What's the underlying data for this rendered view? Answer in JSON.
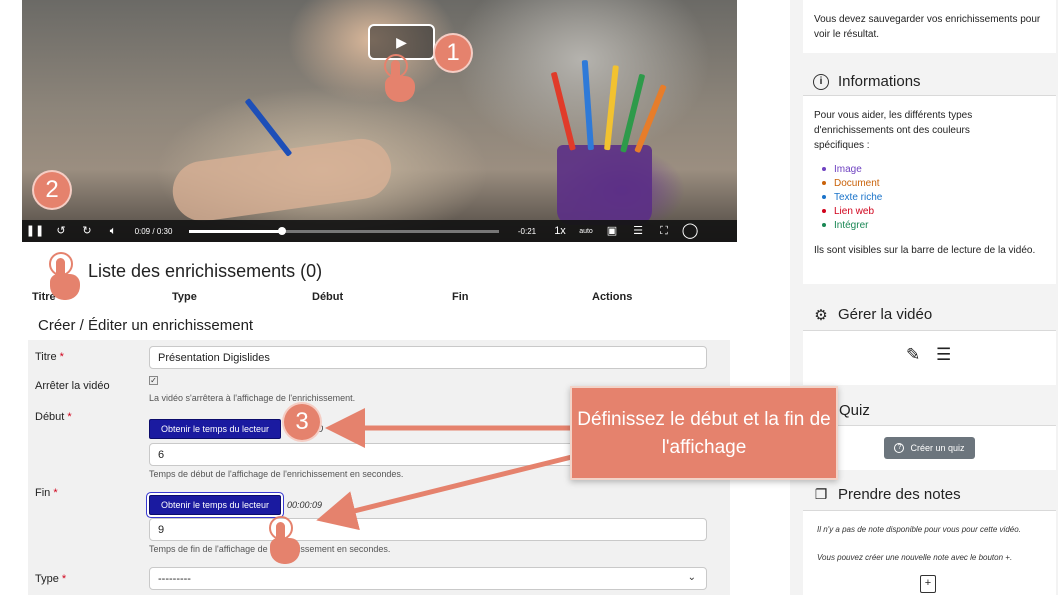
{
  "video": {
    "current_time": "0:09",
    "separator": "/",
    "duration": "0:30",
    "remaining": "-0:21",
    "rate": "1x",
    "quality": "auto",
    "progress": 0.3
  },
  "annotations": {
    "badge1": "1",
    "badge2": "2",
    "badge3": "3",
    "callout_text": "Définissez le début et la fin de l'affichage"
  },
  "list": {
    "title": "Liste des enrichissements (0)",
    "columns": [
      "Titre",
      "Type",
      "Début",
      "Fin",
      "Actions"
    ]
  },
  "form": {
    "title": "Créer / Éditer un enrichissement",
    "required_mark": "*",
    "title_label": "Titre",
    "title_value": "Présentation Digislides",
    "stop_label": "Arrêter la vidéo",
    "stop_checked": true,
    "stop_help": "La vidéo s'arrêtera à l'affichage de l'enrichissement.",
    "start_label": "Début",
    "get_time_button": "Obtenir le temps du lecteur",
    "start_time_readout": "0",
    "start_value": "6",
    "start_help": "Temps de début de l'affichage de l'enrichissement en secondes.",
    "end_label": "Fin",
    "end_time_readout": "00:00:09",
    "end_value": "9",
    "end_help": "Temps de fin de l'affichage de l'enrichissement en secondes.",
    "type_label": "Type",
    "type_value": "---------"
  },
  "sidebar": {
    "save_note": "Vous devez sauvegarder vos enrichissements pour voir le résultat.",
    "info_title": "Informations",
    "info_text": "Pour vous aider, les différents types d'enrichissements ont des couleurs spécifiques :",
    "legend": [
      {
        "label": "Image",
        "color": "#6f42c1"
      },
      {
        "label": "Document",
        "color": "#c9620a"
      },
      {
        "label": "Texte riche",
        "color": "#1a73c9"
      },
      {
        "label": "Lien web",
        "color": "#d0021b"
      },
      {
        "label": "Intégrer",
        "color": "#198754"
      }
    ],
    "visible_text": "Ils sont visibles sur la barre de lecture de la vidéo.",
    "manage_title": "Gérer la vidéo",
    "quiz_title": "Quiz",
    "quiz_button": "Créer un quiz",
    "notes_title": "Prendre des notes",
    "notes_text_1": "Il n'y a pas de note disponible pour vous pour cette vidéo.",
    "notes_text_2": "Vous pouvez créer une nouvelle note avec le bouton +."
  }
}
